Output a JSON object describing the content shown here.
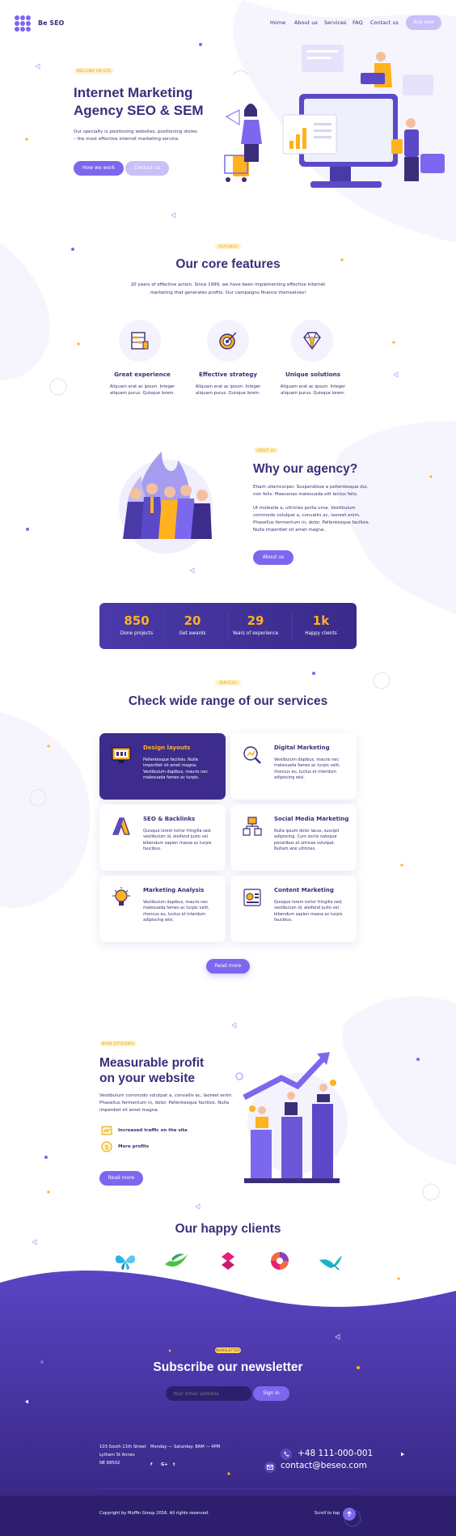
{
  "brand": {
    "name": "Be SEO"
  },
  "nav": {
    "links": [
      "Home",
      "About us",
      "Services",
      "FAQ",
      "Contact us"
    ],
    "buy": "Buy now"
  },
  "hero": {
    "badge": "WELCOME ON SITE",
    "title1": "Internet Marketing",
    "title2": "Agency SEO & SEM",
    "desc1": "Our specialty is positioning websites, positioning stores",
    "desc2": "– the most effective internet marketing service.",
    "btn1": "How we work",
    "btn2": "Contact us"
  },
  "features": {
    "badge": "FEATURES",
    "title": "Our core features",
    "desc1": "20 years of effective action. Since 1999, we have been implementing effective internet",
    "desc2": "marketing that generates profits. Our campaigns finance themselves!",
    "items": [
      {
        "title": "Great experience",
        "desc1": "Aliquam erat ac ipsum. Integer",
        "desc2": "aliquam purus. Quisque lorem."
      },
      {
        "title": "Effective strategy",
        "desc1": "Aliquam erat ac ipsum. Integer",
        "desc2": "aliquam purus. Quisque lorem."
      },
      {
        "title": "Unique solutions",
        "desc1": "Aliquam erat ac ipsum. Integer",
        "desc2": "aliquam purus. Quisque lorem."
      }
    ]
  },
  "about": {
    "badge": "ABOUT US",
    "title": "Why our agency?",
    "p1a": "Etiam ullamcorper. Suspendisse a pellentesque dui,",
    "p1b": "non felis. Maecenas malesuada elit lectus felis.",
    "p2a": "Ut molestie a, ultricies porta urna. Vestibulum",
    "p2b": "commodo volutpat a, convallis ac, laoreet enim.",
    "p2c": "Phasellus fermentum in, dolor. Pellentesque facilisis.",
    "p2d": "Nulla imperdiet sit amet magna.",
    "btn": "About us"
  },
  "stats": [
    {
      "num": "850",
      "label": "Done projects"
    },
    {
      "num": "20",
      "label": "Get awards"
    },
    {
      "num": "29",
      "label": "Years of experience"
    },
    {
      "num": "1k",
      "label": "Happy clients"
    }
  ],
  "services": {
    "badge": "SERVICES",
    "title": "Check wide range of our services",
    "btn": "Read more",
    "items": [
      {
        "title": "Design layouts",
        "lines": [
          "Pellentesque facilisis. Nulla",
          "imperdiet sit amet magna.",
          "Vestibulum dapibus, mauris nec",
          "malesuada fames ac turpis."
        ]
      },
      {
        "title": "Digital Marketing",
        "lines": [
          "Vestibulum dapibus, mauris nec",
          "malesuada fames ac turpis velit,",
          "rhoncus eu, luctus et interdum",
          "adipiscing wisi."
        ]
      },
      {
        "title": "SEO & Backlinks",
        "lines": [
          "Quisque lorem tortor fringilla sed,",
          "vestibulum id, eleifend justo vel",
          "bibendum sapien massa ac turpis",
          "faucibus."
        ]
      },
      {
        "title": "Social Media Marketing",
        "lines": [
          "Nulla ipsum dolor lacus, suscipit",
          "adipiscing. Cum sociis natoque",
          "penatibus et ultrices volutpat.",
          "Nullam wisi ultricies."
        ]
      },
      {
        "title": "Marketing Analysis",
        "lines": [
          "Vestibulum dapibus, mauris nec",
          "malesuada fames ac turpis velit,",
          "rhoncus eu, luctus et interdum",
          "adipiscing wisi."
        ]
      },
      {
        "title": "Content Marketing",
        "lines": [
          "Quisque lorem tortor fringilla sed,",
          "vestibulum id, eleifend justo vel",
          "bibendum sapien massa ac turpis",
          "faucibus."
        ]
      }
    ]
  },
  "profit": {
    "badge": "WORK EFFICIENCY",
    "title1": "Measurable profit",
    "title2": "on your website",
    "d1": "Vestibulum commodo volutpat a, convallis ac, laoreet enim.",
    "d2": "Phasellus fermentum in, dolor. Pellentesque facilisis. Nulla",
    "d3": "imperdiet sit amet magna.",
    "item1": "Increased traffic on the site",
    "item2": "More profits",
    "btn": "Read more"
  },
  "clients": {
    "title": "Our happy clients"
  },
  "newsletter": {
    "badge": "NEWSLETTER",
    "title": "Subscribe our newsletter",
    "placeholder": "Your email address",
    "btn": "Sign in"
  },
  "footer": {
    "addr1": "103 South 11th Street",
    "addr2": "Lytham St Annes",
    "addr3": "NE 68502",
    "hours": "Monday — Saturday: 8AM — 4PM",
    "social": [
      "f",
      "G+",
      "t"
    ],
    "phone": "+48 111-000-001",
    "email": "contact@beseo.com",
    "copyright": "Copyright by Muffin Group 2016. All rights reserved.",
    "scroll": "Scroll to top"
  },
  "colors": {
    "primary": "#7b68ee",
    "dark": "#3b2e79",
    "accent": "#ffb21e",
    "footer": "#3d2c8c"
  }
}
